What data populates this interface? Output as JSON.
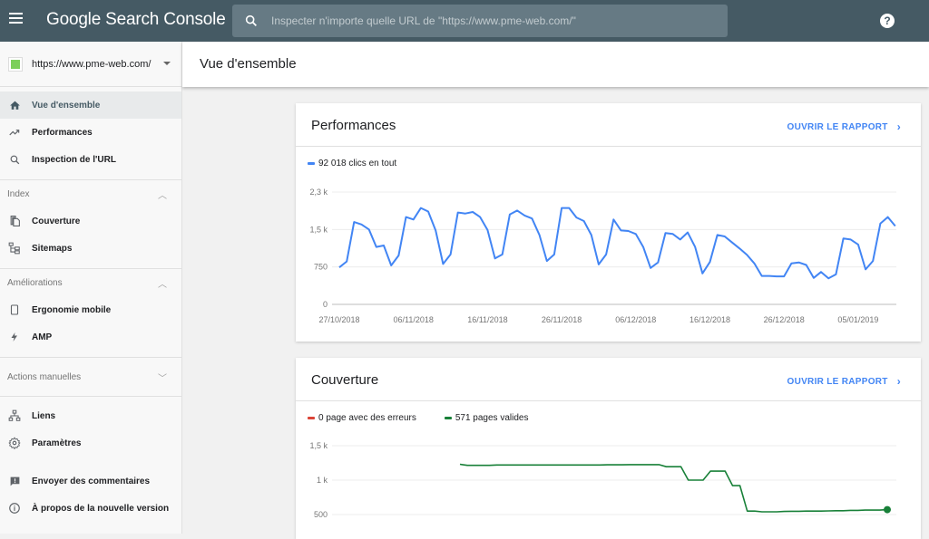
{
  "topbar": {
    "app_title_google": "Google",
    "app_title_product": "Search Console",
    "search_placeholder": "Inspecter n'importe quelle URL de \"https://www.pme-web.com/\"",
    "help_icon_glyph": "?"
  },
  "sidebar": {
    "property_url": "https://www.pme-web.com/",
    "primary_items": [
      {
        "label": "Vue d'ensemble",
        "icon": "home-icon",
        "active": true
      },
      {
        "label": "Performances",
        "icon": "trending-up-icon",
        "active": false
      },
      {
        "label": "Inspection de l'URL",
        "icon": "search-icon",
        "active": false
      }
    ],
    "sections": [
      {
        "label": "Index",
        "expanded": true,
        "items": [
          {
            "label": "Couverture",
            "icon": "copy-icon"
          },
          {
            "label": "Sitemaps",
            "icon": "sitemap-icon"
          }
        ]
      },
      {
        "label": "Améliorations",
        "expanded": true,
        "items": [
          {
            "label": "Ergonomie mobile",
            "icon": "smartphone-icon"
          },
          {
            "label": "AMP",
            "icon": "bolt-icon"
          }
        ]
      },
      {
        "label": "Actions manuelles",
        "expanded": false,
        "items": []
      }
    ],
    "bottom_items": [
      {
        "label": "Liens",
        "icon": "links-icon"
      },
      {
        "label": "Paramètres",
        "icon": "settings-icon"
      },
      {
        "label": "Envoyer des commentaires",
        "icon": "feedback-icon"
      },
      {
        "label": "À propos de la nouvelle version",
        "icon": "info-icon"
      }
    ]
  },
  "header": {
    "title": "Vue d'ensemble"
  },
  "cards": {
    "performance": {
      "title": "Performances",
      "open_report": "OUVRIR LE RAPPORT",
      "legend": "92 018 clics en tout"
    },
    "coverage": {
      "title": "Couverture",
      "open_report": "OUVRIR LE RAPPORT",
      "legend_errors": "0 page avec des erreurs",
      "legend_valid": "571 pages valides"
    }
  },
  "colors": {
    "topbar": "#455a64",
    "clicks_series": "#4285f4",
    "errors_series": "#db4437",
    "valid_series": "#188038",
    "link": "#4285f4"
  },
  "chart_data": [
    {
      "type": "line",
      "title": "Performances",
      "series": [
        {
          "name": "92 018 clics en tout",
          "color": "#4285f4",
          "values": [
            740,
            860,
            1650,
            1600,
            1500,
            1150,
            1180,
            780,
            980,
            1750,
            1700,
            1930,
            1860,
            1480,
            810,
            1000,
            1840,
            1820,
            1850,
            1750,
            1490,
            920,
            1000,
            1800,
            1880,
            1780,
            1720,
            1390,
            870,
            1000,
            1930,
            1930,
            1740,
            1670,
            1390,
            800,
            1000,
            1700,
            1480,
            1470,
            1410,
            1150,
            730,
            840,
            1430,
            1410,
            1300,
            1440,
            1150,
            620,
            850,
            1390,
            1360,
            1240,
            1120,
            990,
            820,
            570,
            570,
            560,
            560,
            820,
            840,
            790,
            530,
            650,
            520,
            600,
            1320,
            1300,
            1200,
            700,
            870,
            1620,
            1750,
            1570
          ]
        }
      ],
      "x_start": "27/10/2018",
      "x_tick_labels": [
        "27/10/2018",
        "06/11/2018",
        "16/11/2018",
        "26/11/2018",
        "06/12/2018",
        "16/12/2018",
        "26/12/2018",
        "05/01/2019"
      ],
      "y_tick_labels": [
        "0",
        "750",
        "1,5 k",
        "2,3 k"
      ],
      "y_ticks": [
        0,
        750,
        1500,
        2250
      ],
      "ylim": [
        0,
        2250
      ],
      "grid": true,
      "legend": "top-left"
    },
    {
      "type": "line",
      "title": "Couverture",
      "series": [
        {
          "name": "0 page avec des erreurs",
          "color": "#db4437",
          "values": []
        },
        {
          "name": "571 pages valides",
          "color": "#188038",
          "values": [
            1230,
            1215,
            1215,
            1215,
            1215,
            1220,
            1220,
            1220,
            1220,
            1220,
            1220,
            1220,
            1220,
            1220,
            1220,
            1220,
            1220,
            1220,
            1220,
            1220,
            1222,
            1222,
            1222,
            1225,
            1225,
            1225,
            1225,
            1225,
            1195,
            1195,
            1195,
            1000,
            1000,
            1000,
            1130,
            1130,
            1130,
            920,
            920,
            550,
            550,
            540,
            540,
            540,
            545,
            548,
            548,
            550,
            550,
            550,
            552,
            555,
            555,
            560,
            560,
            565,
            565,
            565,
            571
          ]
        }
      ],
      "series_start_day_offset": 16,
      "y_tick_labels": [
        "500",
        "1 k",
        "1,5 k"
      ],
      "y_ticks": [
        500,
        1000,
        1500
      ],
      "ylim": [
        0,
        1500
      ],
      "grid": true,
      "legend": "top-left",
      "last_point_marker": true
    }
  ]
}
